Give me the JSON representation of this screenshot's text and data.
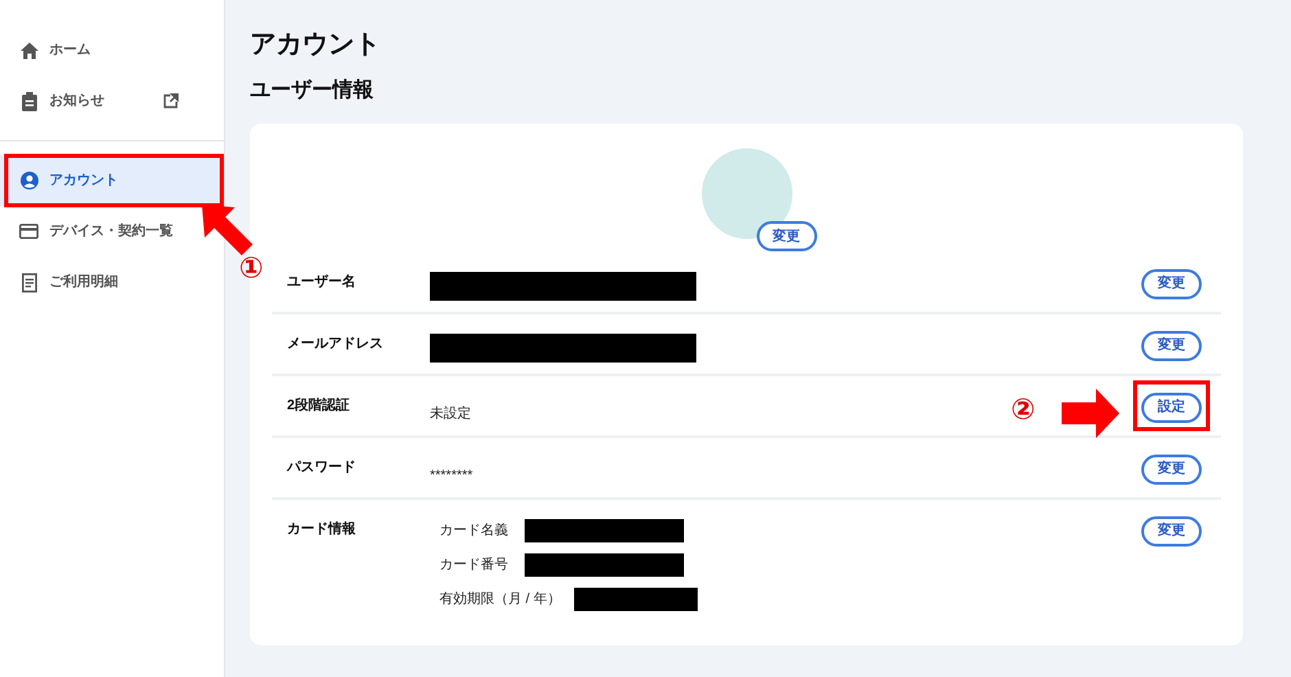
{
  "sidebar": {
    "items": [
      {
        "label": "ホーム",
        "selected": false,
        "external": false,
        "highlighted": false
      },
      {
        "label": "お知らせ",
        "selected": false,
        "external": true,
        "highlighted": false
      },
      {
        "label": "アカウント",
        "selected": true,
        "external": false,
        "highlighted": true
      },
      {
        "label": "デバイス・契約一覧",
        "selected": false,
        "external": false,
        "highlighted": false
      },
      {
        "label": "ご利用明細",
        "selected": false,
        "external": false,
        "highlighted": false
      }
    ]
  },
  "page_title": "アカウント",
  "section_title": "ユーザー情報",
  "avatar": {
    "button": "変更"
  },
  "rows": [
    {
      "label": "ユーザー名",
      "kind": "redacted",
      "button": "変更",
      "highlighted": false
    },
    {
      "label": "メールアドレス",
      "kind": "redacted",
      "button": "変更",
      "highlighted": false
    },
    {
      "label": "2段階認証",
      "kind": "text",
      "value": "未設定",
      "button": "設定",
      "highlighted": true
    },
    {
      "label": "パスワード",
      "kind": "text",
      "value": "********",
      "button": "変更",
      "highlighted": false
    },
    {
      "label": "カード情報",
      "kind": "card",
      "fields": [
        {
          "label": "カード名義"
        },
        {
          "label": "カード番号"
        },
        {
          "label": "有効期限（月 / 年）"
        }
      ],
      "button": "変更",
      "highlighted": false
    }
  ],
  "annotations": [
    "①",
    "②"
  ]
}
